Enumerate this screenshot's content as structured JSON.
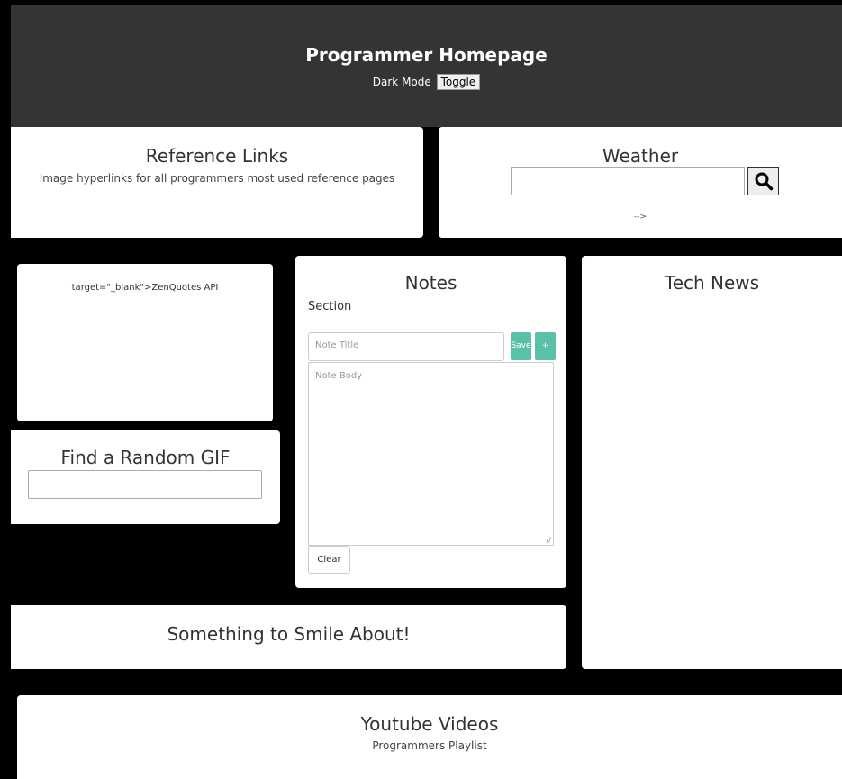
{
  "header": {
    "title": "Programmer Homepage",
    "dark_mode_label": "Dark Mode",
    "toggle_label": "Toggle",
    "background": "#343434"
  },
  "reference": {
    "title": "Reference Links",
    "description": "Image hyperlinks for all programmers most used reference pages"
  },
  "weather": {
    "title": "Weather",
    "search_value": "",
    "search_icon": "magnifier-icon",
    "arrow_text": "-->"
  },
  "quote": {
    "text": "target=\"_blank\">ZenQuotes API"
  },
  "gif": {
    "title": "Find a Random GIF",
    "input_value": ""
  },
  "notes": {
    "title": "Notes",
    "section_label": "Section",
    "title_placeholder": "Note Title",
    "save_label": "Save",
    "add_label": "+",
    "body_placeholder": "Note Body",
    "clear_label": "Clear",
    "accent": "#5bc0a8"
  },
  "tech": {
    "title": "Tech News"
  },
  "smile": {
    "title": "Something to Smile About!"
  },
  "youtube": {
    "title": "Youtube Videos",
    "subtitle": "Programmers Playlist"
  }
}
